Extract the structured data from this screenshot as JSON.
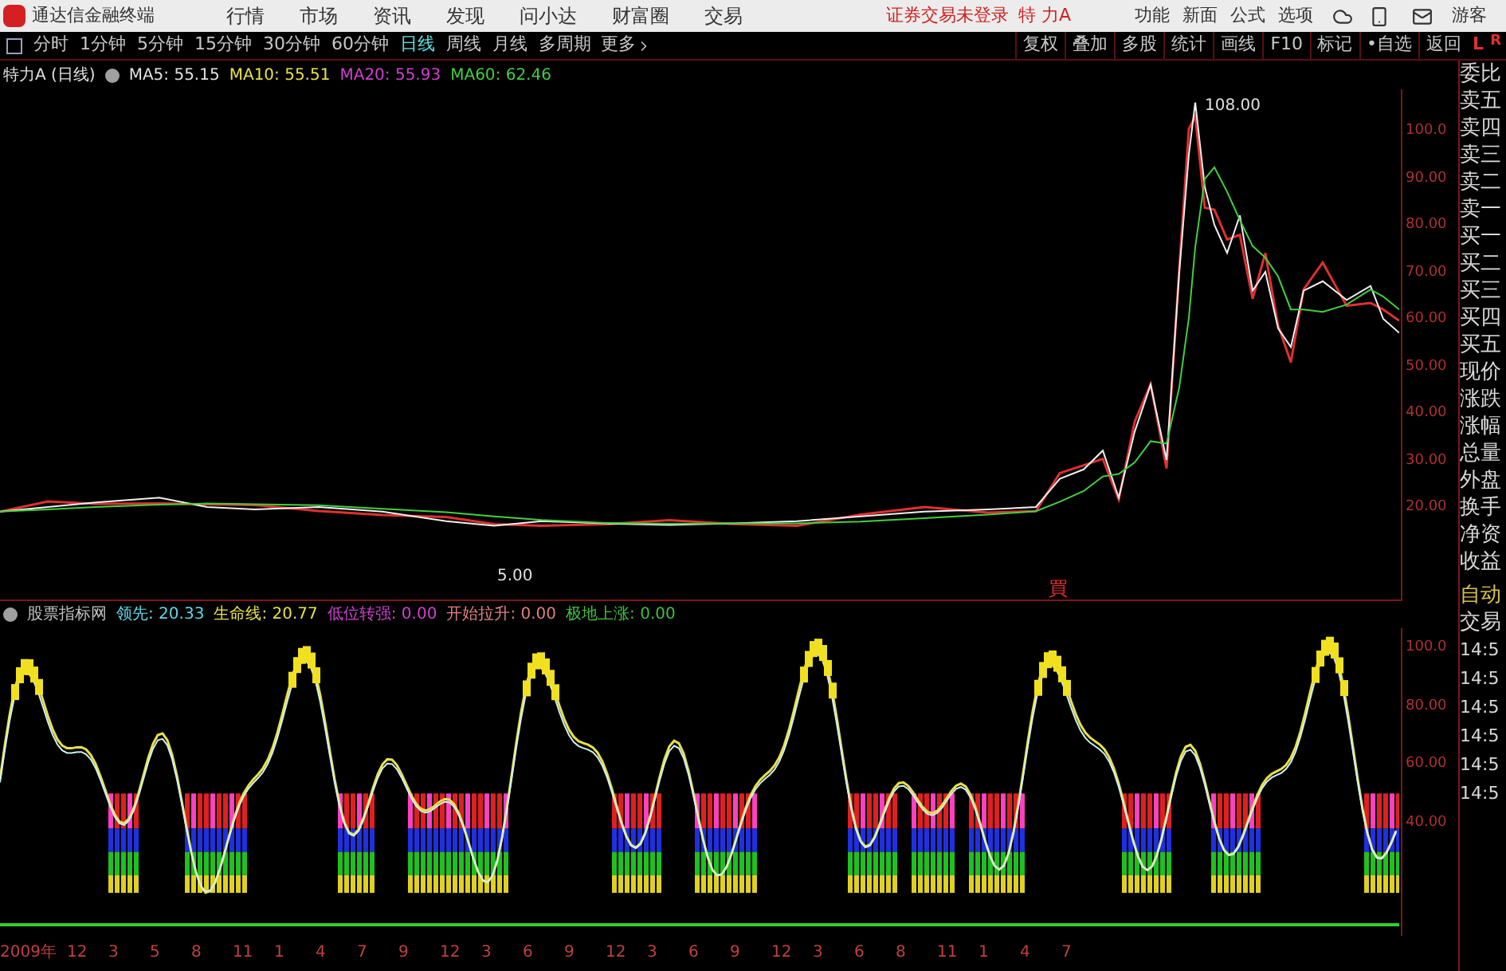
{
  "app": {
    "title": "通达信金融终端"
  },
  "menu": [
    "行情",
    "市场",
    "资讯",
    "发现",
    "问小达",
    "财富圈",
    "交易"
  ],
  "login_status": "证券交易未登录",
  "stock_name": "特 力A",
  "top_links": [
    "功能",
    "新面",
    "公式",
    "选项"
  ],
  "user": "游客",
  "periods": [
    {
      "label": "分时",
      "selected": false
    },
    {
      "label": "1分钟",
      "selected": false
    },
    {
      "label": "5分钟",
      "selected": false
    },
    {
      "label": "15分钟",
      "selected": false
    },
    {
      "label": "30分钟",
      "selected": false
    },
    {
      "label": "60分钟",
      "selected": false
    },
    {
      "label": "日线",
      "selected": true
    },
    {
      "label": "周线",
      "selected": false
    },
    {
      "label": "月线",
      "selected": false
    },
    {
      "label": "多周期",
      "selected": false
    }
  ],
  "more": "更多",
  "tools": [
    "复权",
    "叠加",
    "多股",
    "统计",
    "画线",
    "F10",
    "标记",
    "•自选",
    "返回"
  ],
  "side_tabs": [
    "L",
    "R"
  ],
  "chart": {
    "title": "特力A (日线)",
    "ma": [
      {
        "label": "MA5: 55.15",
        "color": "#e0e0e0"
      },
      {
        "label": "MA10: 55.51",
        "color": "#e8e04a"
      },
      {
        "label": "MA20: 55.93",
        "color": "#d040d0"
      },
      {
        "label": "MA60: 62.46",
        "color": "#40d040"
      }
    ],
    "price_axis": [
      "100.0",
      "90.00",
      "80.00",
      "70.00",
      "60.00",
      "50.00",
      "40.00",
      "30.00",
      "20.00"
    ],
    "high_label": "108.00",
    "low_label": "5.00",
    "signal_mark": "買"
  },
  "indicator": {
    "title": "股票指标网",
    "lines": [
      {
        "label": "领先: 20.33",
        "color": "#60d8e8"
      },
      {
        "label": "生命线: 20.77",
        "color": "#e8e04a"
      },
      {
        "label": "低位转强: 0.00",
        "color": "#d040d0"
      },
      {
        "label": "开始拉升: 0.00",
        "color": "#e08080"
      },
      {
        "label": "极地上涨: 0.00",
        "color": "#40c040"
      }
    ],
    "axis": [
      "100.0",
      "80.00",
      "60.00",
      "40.00"
    ]
  },
  "quote_panel": {
    "items": [
      "委比",
      "卖五",
      "卖四",
      "卖三",
      "卖二",
      "卖一",
      "买一",
      "买二",
      "买三",
      "买四",
      "买五",
      "现价",
      "涨跌",
      "涨幅",
      "总量",
      "外盘",
      "换手",
      "净资",
      "收益"
    ],
    "trade": [
      "自动",
      "交易"
    ],
    "times": [
      "14:5",
      "14:5",
      "14:5",
      "14:5",
      "14:5",
      "14:5"
    ]
  },
  "time_axis": [
    "2009年",
    "12",
    "3",
    "5",
    "8",
    "11",
    "1",
    "4",
    "7",
    "9",
    "12",
    "3",
    "6",
    "9",
    "12",
    "3",
    "6",
    "9",
    "12",
    "3",
    "6",
    "8",
    "11",
    "1",
    "4",
    "7"
  ]
}
